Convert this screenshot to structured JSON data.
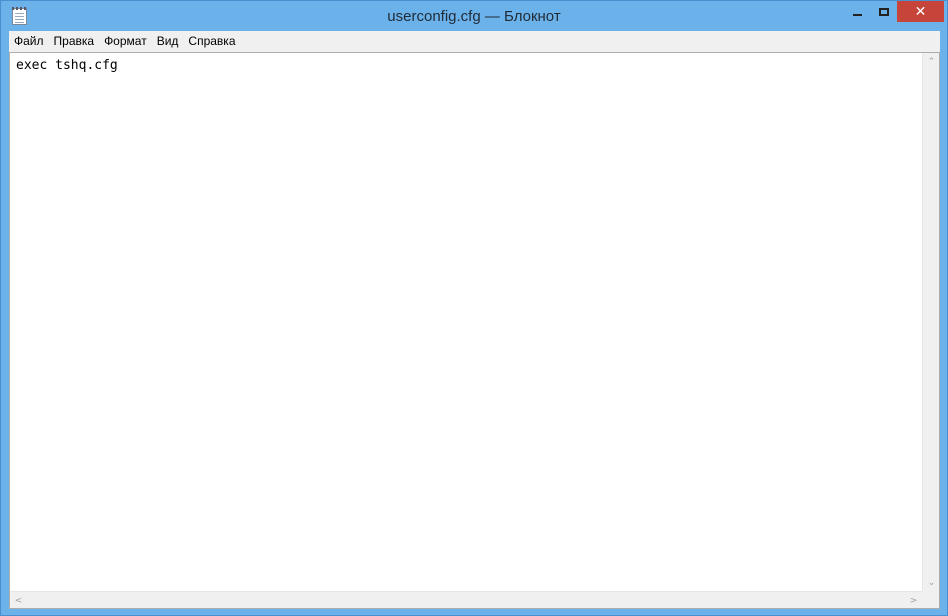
{
  "window": {
    "title": "userconfig.cfg — Блокнот",
    "close_glyph": "✕"
  },
  "menu": {
    "items": [
      {
        "label": "Файл"
      },
      {
        "label": "Правка"
      },
      {
        "label": "Формат"
      },
      {
        "label": "Вид"
      },
      {
        "label": "Справка"
      }
    ]
  },
  "editor": {
    "content": "exec tshq.cfg"
  },
  "scroll": {
    "up": "⌃",
    "down": "⌄",
    "left": "<",
    "right": ">"
  },
  "colors": {
    "titlebar": "#6cb2ea",
    "close_button": "#c7443b",
    "menubar": "#f0f0f0",
    "editor_bg": "#ffffff"
  },
  "icons": {
    "app": "notepad-icon",
    "minimize": "minimize-icon",
    "maximize": "maximize-icon",
    "close": "close-icon"
  }
}
